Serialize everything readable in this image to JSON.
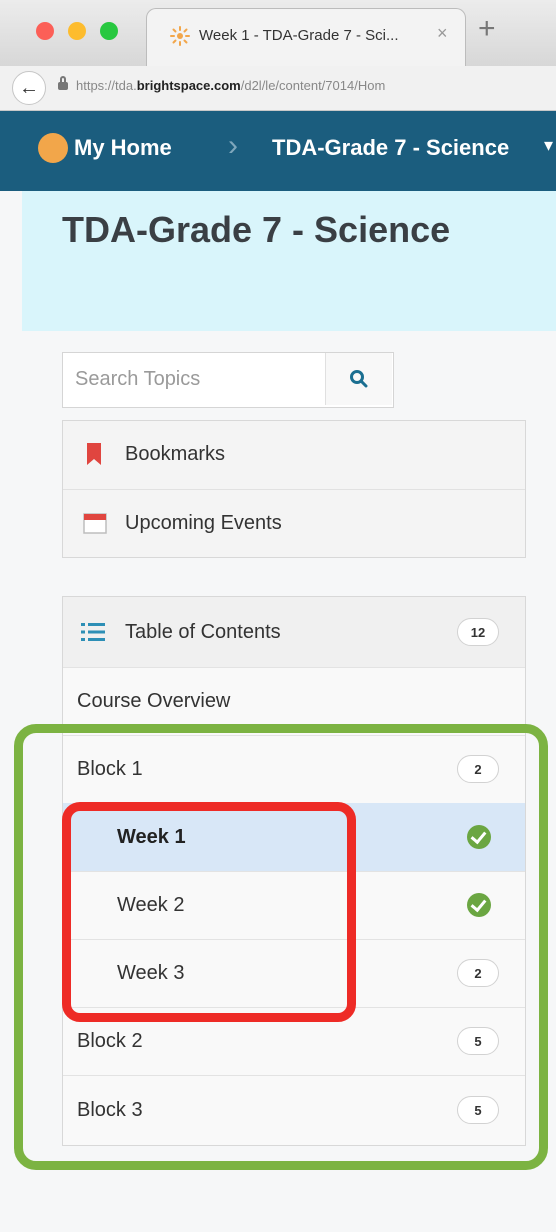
{
  "browser": {
    "tab_title": "Week 1 - TDA-Grade 7 - Sci...",
    "tab_close": "×",
    "new_tab": "+",
    "back": "←",
    "url_prefix": "https://tda.",
    "url_host": "brightspace.com",
    "url_path": "/d2l/le/content/7014/Hom"
  },
  "nav": {
    "home_label": "My Home",
    "separator": "›",
    "course_label": "TDA-Grade 7 - Science",
    "caret": "▾"
  },
  "banner": {
    "title": "TDA-Grade 7 - Science"
  },
  "search": {
    "placeholder": "Search Topics"
  },
  "tools": {
    "bookmarks_label": "Bookmarks",
    "events_label": "Upcoming Events"
  },
  "toc": {
    "header_label": "Table of Contents",
    "header_count": "12",
    "items": [
      {
        "label": "Course Overview"
      },
      {
        "label": "Block 1",
        "count": "2"
      },
      {
        "label": "Week 1",
        "status": "complete"
      },
      {
        "label": "Week 2",
        "status": "complete"
      },
      {
        "label": "Week 3",
        "count": "2"
      },
      {
        "label": "Block 2",
        "count": "5"
      },
      {
        "label": "Block 3",
        "count": "5"
      }
    ]
  },
  "colors": {
    "nav_bg": "#1b5d7e",
    "banner_bg": "#d9f5fb",
    "selected_row": "#d8e7f7",
    "check_green": "#6ba642",
    "highlight_green": "#7cb342",
    "highlight_red": "#ee2b26"
  }
}
